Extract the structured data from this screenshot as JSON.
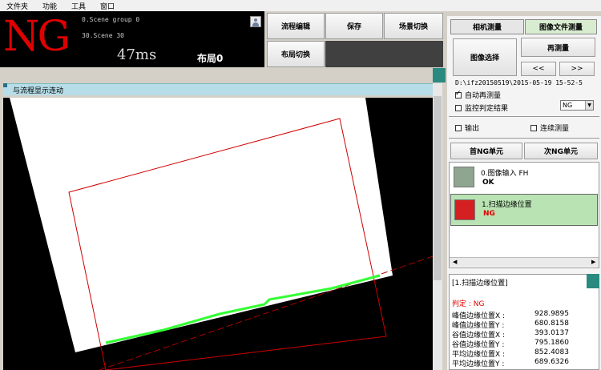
{
  "menu": [
    "文件夹",
    "功能",
    "工具",
    "窗口"
  ],
  "status": {
    "judgement": "NG",
    "scene_group": "0.Scene group 0",
    "scene": "30.Scene 30",
    "time": "47ms",
    "layout": "布局0"
  },
  "toolbar": {
    "flow_edit": "流程编辑",
    "save": "保存",
    "scene_switch": "场景切换",
    "layout_switch": "布局切换"
  },
  "image": {
    "header": "与流程显示连动"
  },
  "right": {
    "tabs": [
      "相机测量",
      "图像文件测量"
    ],
    "image_select": "图像选择",
    "remeasure": "再测量",
    "prev": "<<",
    "next": ">>",
    "path": "D:\\ifz20150519\\2015-05-19 15-52-5",
    "auto_remeasure": "自动再测量",
    "monitor_result": "监控判定结果",
    "ng_option": "NG",
    "output": "输出",
    "continuous": "连续测量",
    "first_ng": "首NG单元",
    "next_ng": "次NG单元"
  },
  "units": [
    {
      "title": "0.图像输入 FH",
      "result": "OK"
    },
    {
      "title": "1.扫描边缘位置",
      "result": "NG"
    }
  ],
  "detail": {
    "title": "[1.扫描边缘位置]",
    "judge": "判定 : NG",
    "rows": [
      {
        "k": "峰值边缘位置X :",
        "v": "928.9895"
      },
      {
        "k": "峰值边缘位置Y :",
        "v": "680.8158"
      },
      {
        "k": "谷值边缘位置X :",
        "v": "393.0137"
      },
      {
        "k": "谷值边缘位置Y :",
        "v": "795.1860"
      },
      {
        "k": "平均边缘位置X :",
        "v": "852.4083"
      },
      {
        "k": "平均边缘位置Y :",
        "v": "689.6326"
      }
    ]
  },
  "colors": {
    "ng_red": "#e00000",
    "tab_active": "#d8ecd0",
    "ng_unit_bg": "#b9e3b3",
    "edge_green": "#33ff33"
  }
}
